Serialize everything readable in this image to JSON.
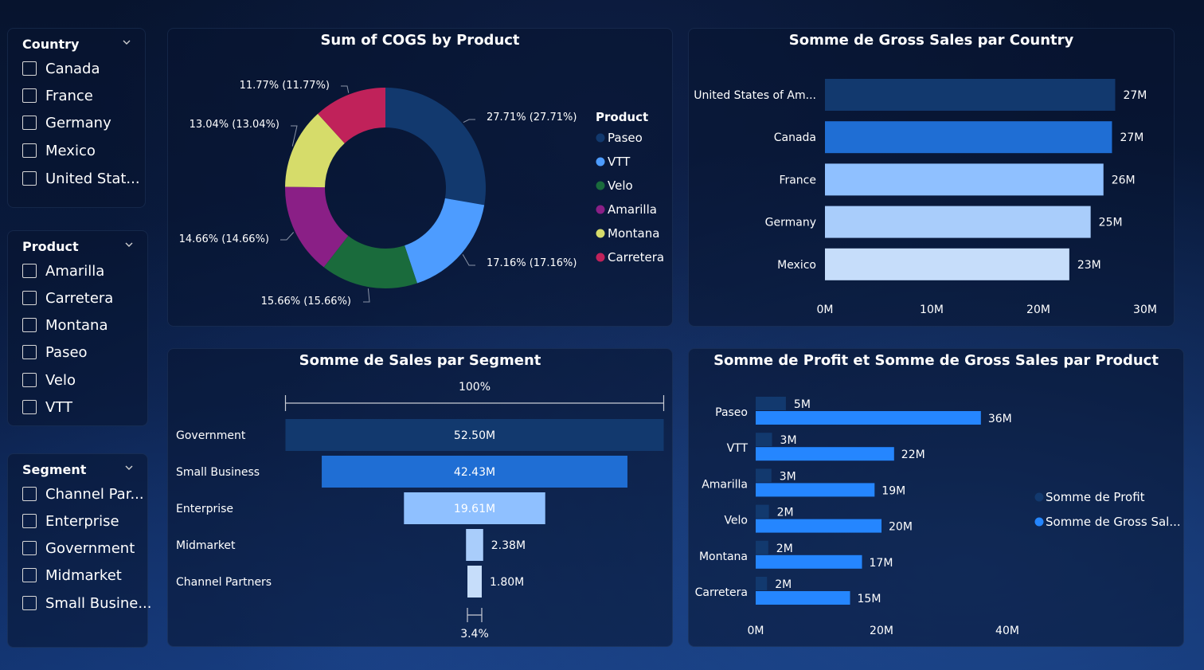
{
  "slicers": {
    "country": {
      "title": "Country",
      "items": [
        "Canada",
        "France",
        "Germany",
        "Mexico",
        "United Stat..."
      ]
    },
    "product": {
      "title": "Product",
      "items": [
        "Amarilla",
        "Carretera",
        "Montana",
        "Paseo",
        "Velo",
        "VTT"
      ]
    },
    "segment": {
      "title": "Segment",
      "items": [
        "Channel Par...",
        "Enterprise",
        "Government",
        "Midmarket",
        "Small Busine..."
      ]
    }
  },
  "colors": {
    "dark_navy": "#12396e",
    "royal_blue": "#1f6ed4",
    "medium_blue": "#5aa3ff",
    "sky_blue": "#8fc0ff",
    "pale_blue": "#a9cdfb",
    "lightest_blue": "#c6ddfa",
    "green": "#1a6b3c",
    "purple": "#8a1f86",
    "yellow": "#d6dc6a",
    "crimson": "#c0225a",
    "bright_blue": "#2586ff"
  },
  "chart_data": [
    {
      "type": "pie",
      "title": "Sum of COGS by Product",
      "legend_title": "Product",
      "legend_position": "right",
      "slices": [
        {
          "name": "Paseo",
          "percent": 27.71,
          "label": "27.71% (27.71%)",
          "color": "#12396e"
        },
        {
          "name": "VTT",
          "percent": 17.16,
          "label": "17.16% (17.16%)",
          "color": "#4d9cff"
        },
        {
          "name": "Velo",
          "percent": 15.66,
          "label": "15.66% (15.66%)",
          "color": "#1a6b3c"
        },
        {
          "name": "Amarilla",
          "percent": 14.66,
          "label": "14.66% (14.66%)",
          "color": "#8a1f86"
        },
        {
          "name": "Montana",
          "percent": 13.04,
          "label": "13.04% (13.04%)",
          "color": "#d6dc6a"
        },
        {
          "name": "Carretera",
          "percent": 11.77,
          "label": "11.77% (11.77%)",
          "color": "#c0225a"
        }
      ]
    },
    {
      "type": "bar",
      "orientation": "horizontal",
      "title": "Somme de Gross Sales par Country",
      "categories": [
        "United States of Am...",
        "Canada",
        "France",
        "Germany",
        "Mexico"
      ],
      "values": [
        27.2,
        26.9,
        26.1,
        24.9,
        22.9
      ],
      "data_labels": [
        "27M",
        "27M",
        "26M",
        "25M",
        "23M"
      ],
      "colors": [
        "#12396e",
        "#1f6ed4",
        "#8fc0ff",
        "#a9cdfb",
        "#c6ddfa"
      ],
      "xlim": [
        0,
        30
      ],
      "xticks": [
        "0M",
        "10M",
        "20M",
        "30M"
      ],
      "grid": false
    },
    {
      "type": "bar",
      "subtype": "funnel",
      "title": "Somme de Sales par Segment",
      "categories": [
        "Government",
        "Small Business",
        "Enterprise",
        "Midmarket",
        "Channel Partners"
      ],
      "values": [
        52.5,
        42.43,
        19.61,
        2.38,
        1.8
      ],
      "data_labels": [
        "52.50M",
        "42.43M",
        "19.61M",
        "2.38M",
        "1.80M"
      ],
      "colors": [
        "#12396e",
        "#1f6ed4",
        "#8fc0ff",
        "#a9cdfb",
        "#c6ddfa"
      ],
      "top_percent_label": "100%",
      "bottom_percent_label": "3.4%"
    },
    {
      "type": "bar",
      "orientation": "horizontal",
      "title": "Somme de Profit et Somme de Gross Sales par Product",
      "categories": [
        "Paseo",
        "VTT",
        "Amarilla",
        "Velo",
        "Montana",
        "Carretera"
      ],
      "legend_position": "right",
      "xlim": [
        0,
        60
      ],
      "xticks": [
        "0M",
        "20M",
        "40M"
      ],
      "series": [
        {
          "name": "Somme de Profit",
          "legend_label": "Somme de Profit",
          "color": "#12396e",
          "values": [
            4.8,
            2.6,
            2.5,
            2.1,
            2.0,
            1.8
          ],
          "data_labels": [
            "5M",
            "3M",
            "3M",
            "2M",
            "2M",
            "2M"
          ]
        },
        {
          "name": "Somme de Gross Sales",
          "legend_label": "Somme de Gross Sal...",
          "color": "#2586ff",
          "values": [
            35.8,
            22.0,
            18.9,
            20.0,
            16.9,
            15.0
          ],
          "data_labels": [
            "36M",
            "22M",
            "19M",
            "20M",
            "17M",
            "15M"
          ]
        }
      ]
    }
  ]
}
